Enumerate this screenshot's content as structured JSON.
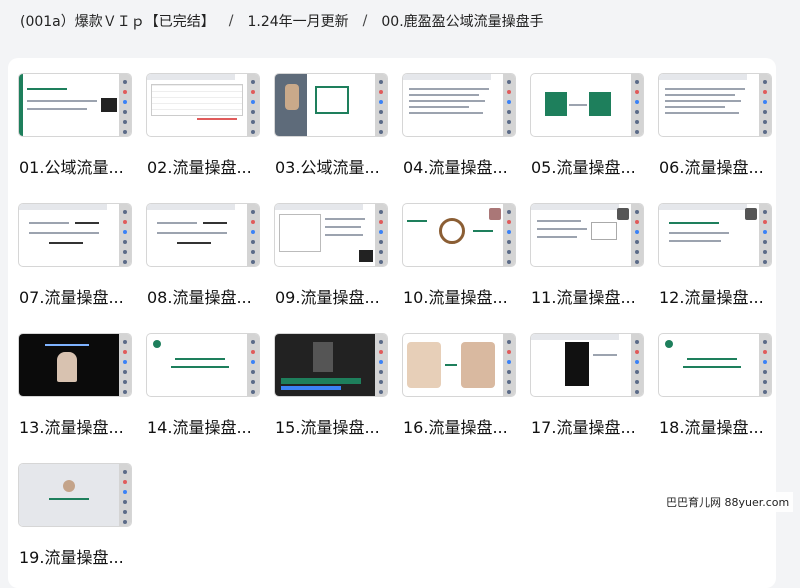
{
  "breadcrumb": {
    "items": [
      "(001a）爆款ＶＩｐ【已完结】",
      "1.24年一月更新",
      "00.鹿盈盈公域流量操盘手"
    ],
    "separator": "/"
  },
  "files": [
    {
      "title": "01.公域流量...",
      "thumb": "title-slide"
    },
    {
      "title": "02.流量操盘...",
      "thumb": "spreadsheet"
    },
    {
      "title": "03.公域流量...",
      "thumb": "portrait-slide"
    },
    {
      "title": "04.流量操盘...",
      "thumb": "document"
    },
    {
      "title": "05.流量操盘...",
      "thumb": "two-boxes"
    },
    {
      "title": "06.流量操盘...",
      "thumb": "document"
    },
    {
      "title": "07.流量操盘...",
      "thumb": "form"
    },
    {
      "title": "08.流量操盘...",
      "thumb": "form"
    },
    {
      "title": "09.流量操盘...",
      "thumb": "table"
    },
    {
      "title": "10.流量操盘...",
      "thumb": "wheel"
    },
    {
      "title": "11.流量操盘...",
      "thumb": "checklist"
    },
    {
      "title": "12.流量操盘...",
      "thumb": "text-slide"
    },
    {
      "title": "13.流量操盘...",
      "thumb": "dark-video"
    },
    {
      "title": "14.流量操盘...",
      "thumb": "green-title"
    },
    {
      "title": "15.流量操盘...",
      "thumb": "video-editor"
    },
    {
      "title": "16.流量操盘...",
      "thumb": "versus"
    },
    {
      "title": "17.流量操盘...",
      "thumb": "dark-phone"
    },
    {
      "title": "18.流量操盘...",
      "thumb": "green-title"
    },
    {
      "title": "19.流量操盘...",
      "thumb": "blank-avatar"
    }
  ],
  "watermark": "巴巴育儿网 88yuer.com",
  "colors": {
    "background": "#f3f4f6",
    "panel": "#ffffff",
    "accent_green": "#1e7f5c",
    "rail": "#d4d4d4"
  }
}
